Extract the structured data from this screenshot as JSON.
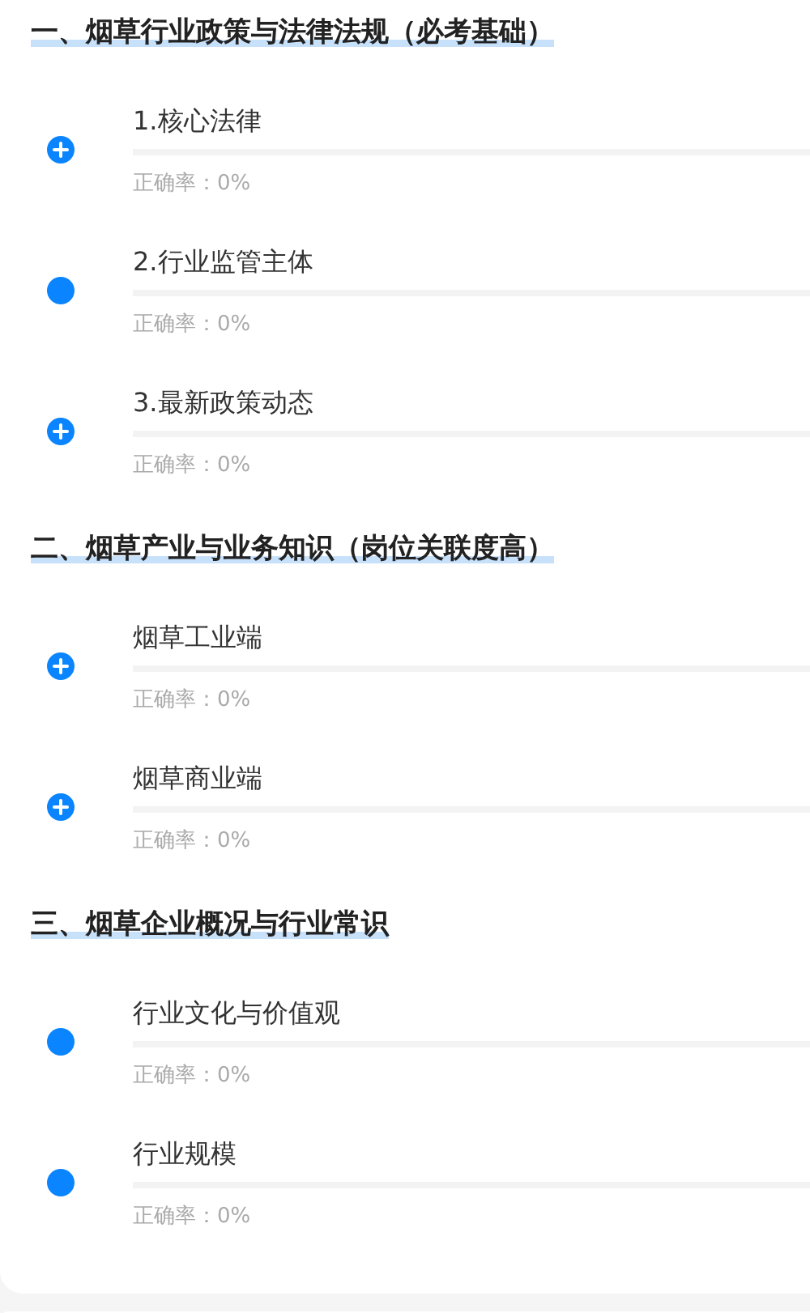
{
  "sections": [
    {
      "title": "一、烟草行业政策与法律法规（必考基础）",
      "items": [
        {
          "kind": "expandable",
          "title": "1.核心法律",
          "level": 0,
          "accuracy": "正确率：0%"
        },
        {
          "kind": "leaf",
          "title": "2.行业监管主体",
          "level": 0,
          "accuracy": "正确率：0%"
        },
        {
          "kind": "expandable",
          "title": "3.最新政策动态",
          "level": 0,
          "accuracy": "正确率：0%"
        }
      ]
    },
    {
      "title": "二、烟草产业与业务知识（岗位关联度高）",
      "items": [
        {
          "kind": "expandable",
          "title": "烟草工业端",
          "level": 0,
          "accuracy": "正确率：0%"
        },
        {
          "kind": "expandable",
          "title": "烟草商业端",
          "level": 0,
          "accuracy": "正确率：0%"
        }
      ]
    },
    {
      "title": "三、烟草企业概况与行业常识",
      "items": [
        {
          "kind": "leaf",
          "title": "行业文化与价值观",
          "level": 0,
          "accuracy": "正确率：0%"
        },
        {
          "kind": "leaf",
          "title": "行业规模",
          "level": 0,
          "accuracy": "正确率：0%"
        }
      ]
    }
  ]
}
